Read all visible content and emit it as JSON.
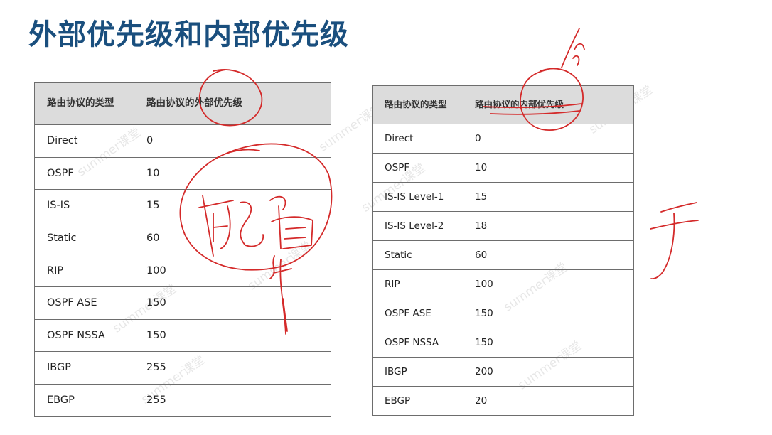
{
  "title": "外部优先级和内部优先级",
  "watermark": "summer课堂",
  "external_table": {
    "headers": [
      "路由协议的类型",
      "路由协议的外部优先级"
    ],
    "rows": [
      [
        "Direct",
        "0"
      ],
      [
        "OSPF",
        "10"
      ],
      [
        "IS-IS",
        "15"
      ],
      [
        "Static",
        "60"
      ],
      [
        "RIP",
        "100"
      ],
      [
        "OSPF ASE",
        "150"
      ],
      [
        "OSPF NSSA",
        "150"
      ],
      [
        "IBGP",
        "255"
      ],
      [
        "EBGP",
        "255"
      ]
    ]
  },
  "internal_table": {
    "headers": [
      "路由协议的类型",
      "路由协议的内部优先级"
    ],
    "rows": [
      [
        "Direct",
        "0"
      ],
      [
        "OSPF",
        "10"
      ],
      [
        "IS-IS Level-1",
        "15"
      ],
      [
        "IS-IS Level-2",
        "18"
      ],
      [
        "Static",
        "60"
      ],
      [
        "RIP",
        "100"
      ],
      [
        "OSPF ASE",
        "150"
      ],
      [
        "OSPF NSSA",
        "150"
      ],
      [
        "IBGP",
        "200"
      ],
      [
        "EBGP",
        "20"
      ]
    ]
  },
  "annotation_color": "#d42a2a"
}
